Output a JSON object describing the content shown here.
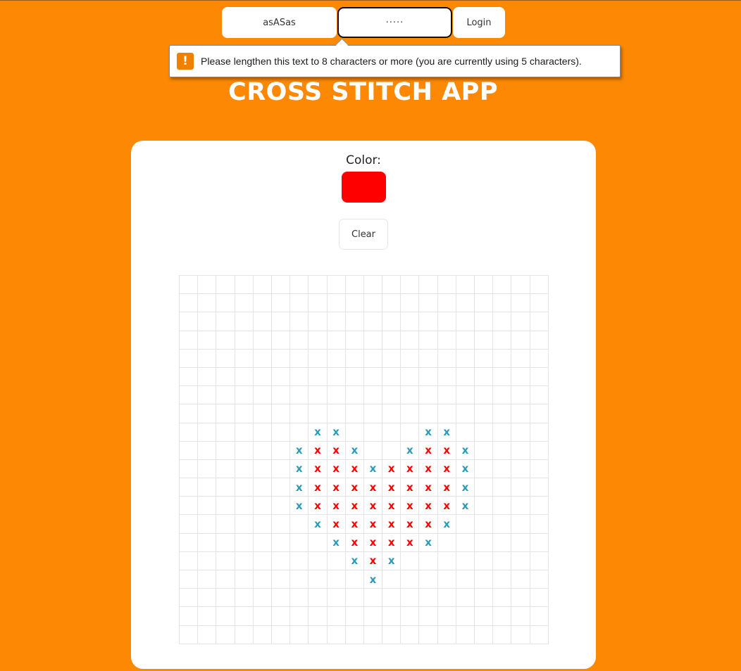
{
  "login": {
    "username_value": "asASas",
    "password_value": "·····",
    "login_label": "Login"
  },
  "tooltip": {
    "icon": "!",
    "text": "Please lengthen this text to 8 characters or more (you are currently using 5 characters)."
  },
  "title": "CROSS STITCH APP",
  "card": {
    "color_label": "Color:",
    "selected_color": "#ff0000",
    "clear_label": "Clear"
  },
  "grid": {
    "cols": 20,
    "rows": 20,
    "stitch_glyph": "x",
    "palette": {
      "R": "#ff0000",
      "B": "#2a9bb8"
    },
    "pattern": [
      "....................",
      "....................",
      "....................",
      "....................",
      "....................",
      "....................",
      "....................",
      "....................",
      ".......BB....BB.....",
      "......BRRB..BRRB....",
      "......BRRRBRRRRB....",
      "......BRRRRRRRRB....",
      "......BRRRRRRRRB....",
      ".......BRRRRRRB.....",
      "........BRRRRB......",
      ".........BRB........",
      "..........B.........",
      "....................",
      "....................",
      "...................."
    ]
  }
}
